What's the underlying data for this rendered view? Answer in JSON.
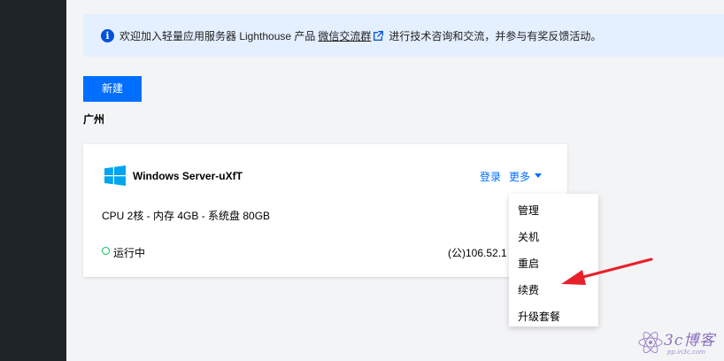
{
  "notice": {
    "text_before": "欢迎加入轻量应用服务器 Lighthouse 产品",
    "link_text": "微信交流群",
    "text_after": "进行技术咨询和交流，并参与有奖反馈活动。"
  },
  "toolbar": {
    "new_label": "新建"
  },
  "region": "广州",
  "instance": {
    "name": "Windows Server-uXfT",
    "login_label": "登录",
    "more_label": "更多",
    "spec": "CPU 2核 - 内存 4GB - 系统盘 80GB",
    "status": "运行中",
    "ip": "(公)106.52.1"
  },
  "menu": {
    "items": [
      "管理",
      "关机",
      "重启",
      "续费",
      "升级套餐"
    ]
  },
  "watermark": {
    "text": "3c博客",
    "sub": "pp.in3c.com"
  },
  "colors": {
    "accent": "#006eff",
    "notice_bg": "#e4efff",
    "status_running": "#0abf5b",
    "arrow": "#e8202a",
    "left_rail": "#1f2429"
  }
}
